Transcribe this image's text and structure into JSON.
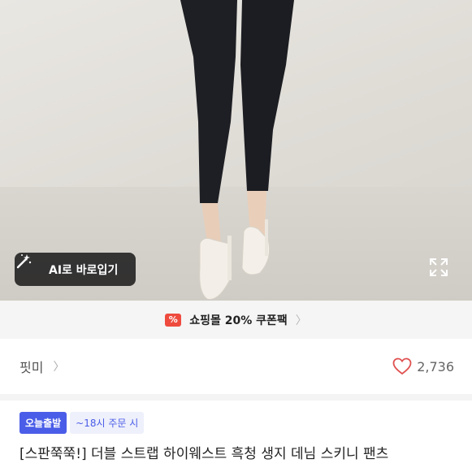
{
  "product_image": {
    "ai_button_label": "AI로 바로입기"
  },
  "coupon": {
    "label": "쇼핑몰 20% 쿠폰팩"
  },
  "shop": {
    "name": "핏미",
    "likes": "2,736"
  },
  "badges": {
    "delivery": "오늘출발",
    "order_time": "~18시 주문 시"
  },
  "product": {
    "title": "[스판쭉쭉!] 더블 스트랩 하이웨스트 흑청 생지 데님 스키니 팬츠"
  },
  "colors": {
    "accent_blue": "#4a5de8",
    "coupon_red": "#ee4b3e",
    "heart_red": "#e05050"
  },
  "icons": [
    "magic-wand-icon",
    "expand-icon",
    "coupon-icon",
    "chevron-right-icon",
    "heart-icon"
  ]
}
